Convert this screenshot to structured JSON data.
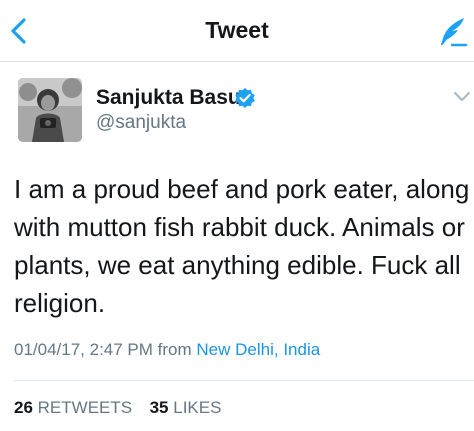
{
  "navbar": {
    "title": "Tweet",
    "back_icon": "chevron-left-icon",
    "compose_icon": "compose-tweet-icon",
    "accent_color": "#1da1f2"
  },
  "author": {
    "name": "Sanjukta Basu",
    "handle": "@sanjukta",
    "verified": true,
    "verified_color": "#1da1f2"
  },
  "tweet": {
    "text": "I am a proud beef and pork eater, along with mutton fish rabbit duck. Animals or plants, we eat anything edible. Fuck all religion.",
    "timestamp": "01/04/17, 2:47 PM",
    "from_label": "from",
    "location": "New Delhi, India",
    "link_color": "#1b95e0"
  },
  "stats": {
    "retweets_count": "26",
    "retweets_label": "RETWEETS",
    "likes_count": "35",
    "likes_label": "LIKES"
  }
}
